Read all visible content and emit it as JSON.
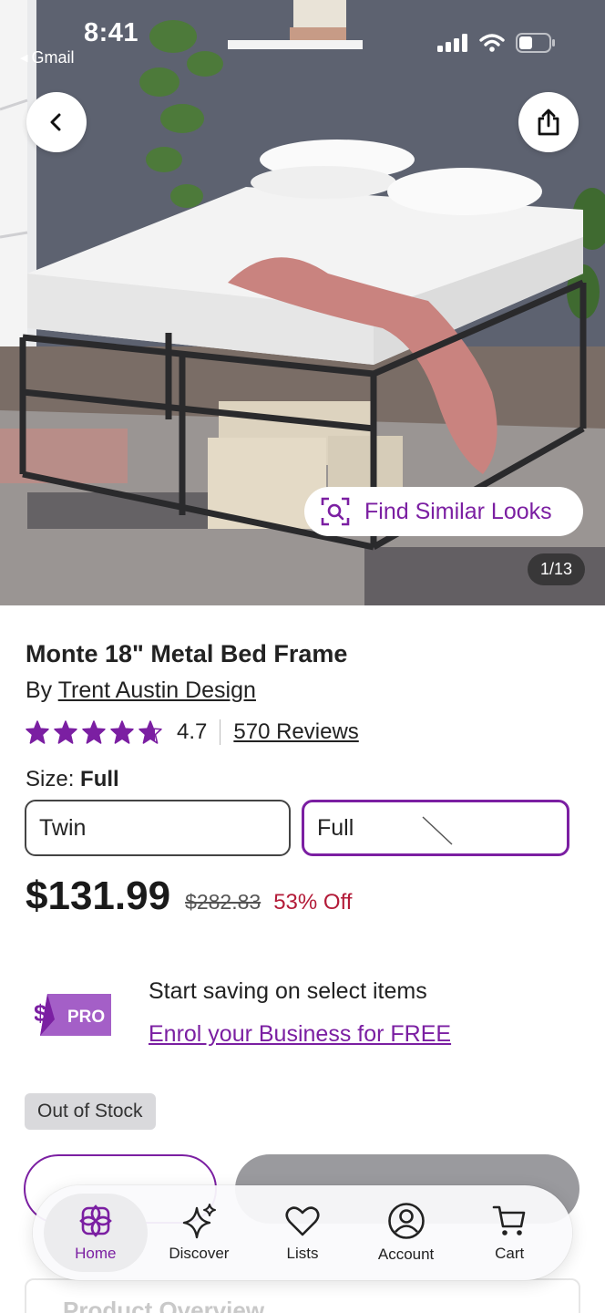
{
  "status_bar": {
    "time": "8:41",
    "back_app": "Gmail"
  },
  "hero": {
    "back_icon": "chevron-left-icon",
    "share_icon": "share-icon",
    "find_similar_label": "Find Similar Looks",
    "image_counter": "1/13"
  },
  "product": {
    "title": "Monte 18\" Metal Bed Frame",
    "by_prefix": "By",
    "brand": "Trent Austin Design",
    "rating": "4.7",
    "rating_stars": 4.7,
    "reviews": "570 Reviews",
    "size_label": "Size:",
    "size_selected": "Full",
    "size_options": [
      "Twin",
      "Full"
    ],
    "price": "$131.99",
    "was_price": "$282.83",
    "discount": "53% Off"
  },
  "pro": {
    "badge_label": "PRO",
    "badge_symbol": "$",
    "line1": "Start saving on select items",
    "link": "Enrol your Business for FREE"
  },
  "stock": {
    "status": "Out of Stock"
  },
  "section": {
    "overview": "Product Overview"
  },
  "tabbar": {
    "items": [
      {
        "label": "Home",
        "icon": "home-icon",
        "active": true
      },
      {
        "label": "Discover",
        "icon": "sparkle-icon",
        "active": false
      },
      {
        "label": "Lists",
        "icon": "heart-icon",
        "active": false
      },
      {
        "label": "Account",
        "icon": "account-icon",
        "active": false
      },
      {
        "label": "Cart",
        "icon": "cart-icon",
        "active": false
      }
    ]
  },
  "colors": {
    "brand_purple": "#7b1fa2",
    "discount_red": "#b31b38",
    "disabled_gray": "#9a9a9e"
  }
}
